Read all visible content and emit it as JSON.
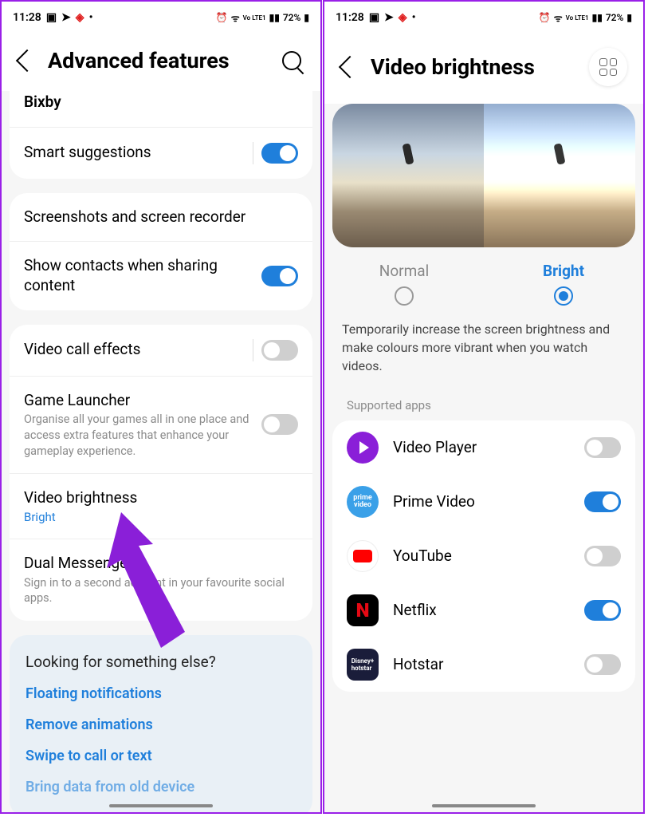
{
  "status": {
    "time": "11:28",
    "battery": "72%",
    "network": "Vo LTE1"
  },
  "left": {
    "title": "Advanced features",
    "rows": {
      "bixby": "Bixby",
      "smart_suggestions": "Smart suggestions",
      "screenshots": "Screenshots and screen recorder",
      "contacts_sharing": "Show contacts when sharing content",
      "video_call": "Video call effects",
      "game_launcher": "Game Launcher",
      "game_launcher_sub": "Organise all your games all in one place and access extra features that enhance your gameplay experience.",
      "video_brightness": "Video brightness",
      "video_brightness_value": "Bright",
      "dual_messenger": "Dual Messenger",
      "dual_messenger_sub": "Sign in to a second account in your favourite social apps."
    },
    "help": {
      "title": "Looking for something else?",
      "links": [
        "Floating notifications",
        "Remove animations",
        "Swipe to call or text",
        "Bring data from old device"
      ]
    }
  },
  "right": {
    "title": "Video brightness",
    "modes": {
      "normal": "Normal",
      "bright": "Bright"
    },
    "description": "Temporarily increase the screen brightness and make colours more vibrant when you watch videos.",
    "section": "Supported apps",
    "apps": [
      {
        "name": "Video Player",
        "on": false
      },
      {
        "name": "Prime Video",
        "on": true
      },
      {
        "name": "YouTube",
        "on": false
      },
      {
        "name": "Netflix",
        "on": true
      },
      {
        "name": "Hotstar",
        "on": false
      }
    ]
  },
  "arrow_color": "#8a1fd8"
}
